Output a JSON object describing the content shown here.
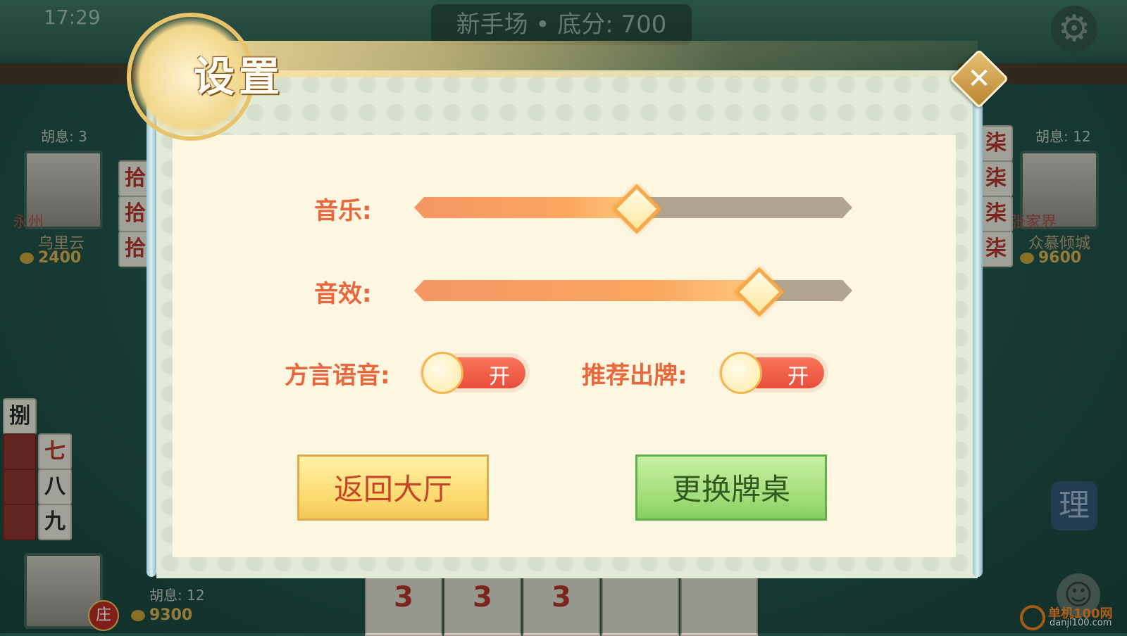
{
  "status_bar": {
    "time": "17:29"
  },
  "table": {
    "room_info": "新手场 • 底分: 700"
  },
  "players": {
    "left": {
      "hu": "胡息: 3",
      "name": "乌里云",
      "coins": "2400",
      "city": "永州"
    },
    "right": {
      "hu": "胡息: 12",
      "name": "众慕倾城",
      "coins": "9600",
      "city": "张家界"
    },
    "self": {
      "hu": "胡息: 12",
      "coins": "9300",
      "dealer_badge": "庄"
    }
  },
  "tiles": {
    "left_column": [
      "拾",
      "拾",
      "拾"
    ],
    "right_column": [
      "柒",
      "柒",
      "柒",
      "柒"
    ],
    "left_meld": [
      "捌",
      "七",
      "八",
      "九"
    ],
    "hand": [
      "3",
      "3",
      "3"
    ]
  },
  "buttons": {
    "sort": "理"
  },
  "settings": {
    "title": "设置",
    "music": {
      "label": "音乐:",
      "level": 0.5
    },
    "sound": {
      "label": "音效:",
      "level": 0.78
    },
    "dialect": {
      "label": "方言语音:",
      "state": "开"
    },
    "recommend": {
      "label": "推荐出牌:",
      "state": "开"
    },
    "back_button": "返回大厅",
    "change_table_button": "更换牌桌"
  },
  "watermark": {
    "line1": "单机100网",
    "line2": "danji100.com"
  }
}
